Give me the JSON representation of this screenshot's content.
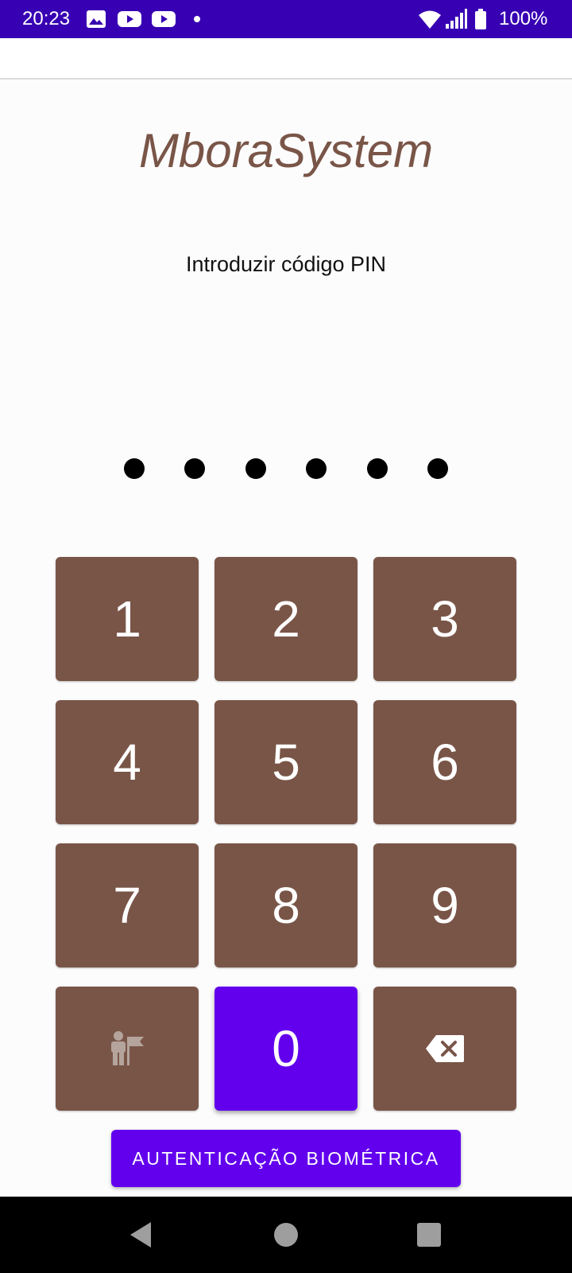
{
  "status_bar": {
    "time": "20:23",
    "battery_text": "100%",
    "icons": [
      "image-icon",
      "youtube-icon",
      "youtube-icon",
      "notification-dot-icon",
      "wifi-icon",
      "signal-icon",
      "battery-icon"
    ]
  },
  "app": {
    "title": "MboraSystem",
    "prompt": "Introduzir código PIN",
    "pin_length": 6
  },
  "keypad": {
    "keys": [
      "1",
      "2",
      "3",
      "4",
      "5",
      "6",
      "7",
      "8",
      "9"
    ],
    "zero": "0",
    "left_icon": "guide-flag-icon",
    "right_icon": "backspace-icon"
  },
  "biometric_button": {
    "label": "AUTENTICAÇÃO BIOMÉTRICA"
  },
  "nav_bar": {
    "icons": [
      "back-icon",
      "home-icon",
      "recents-icon"
    ]
  },
  "colors": {
    "status_bar": "#3700b3",
    "key": "#795548",
    "accent": "#6200ee",
    "title": "#795548"
  }
}
